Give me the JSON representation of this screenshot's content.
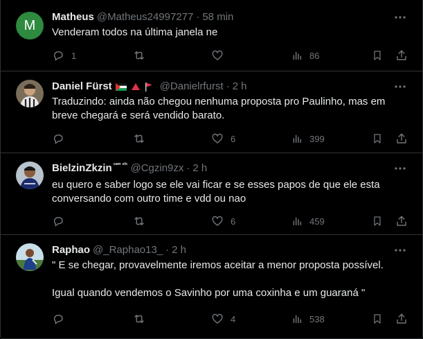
{
  "colors": {
    "background": "#000000",
    "text": "#e7e9ea",
    "muted": "#71767b",
    "divider": "#2f3336"
  },
  "tweets": [
    {
      "name": "Matheus",
      "handle": "@Matheus24997277",
      "separator": "·",
      "time": "58 min",
      "avatar_letter": "M",
      "text": [
        "Venderam todos na última janela ne"
      ],
      "replies": "1",
      "retweets": "",
      "likes": "",
      "views": "86"
    },
    {
      "name": "Daniel Fürst",
      "badges": [
        "palestine-flag-icon",
        "red-triangle-icon",
        "red-flag-icon"
      ],
      "handle": "@Danielrfurst",
      "separator": "·",
      "time": "2 h",
      "text": [
        "Traduzindo: ainda não chegou nenhuma proposta pro Paulinho, mas em breve chegará e será vendido barato."
      ],
      "replies": "",
      "retweets": "",
      "likes": "6",
      "views": "399"
    },
    {
      "name": "BielzinZkzin",
      "name_suffix": "ᶜᵃᵐ ˢᶠᶜ",
      "handle": "@Cgzin9zx",
      "separator": "·",
      "time": "2 h",
      "text": [
        "eu quero e saber logo se ele vai ficar e se esses papos de que ele esta conversando com outro time e vdd ou nao"
      ],
      "replies": "",
      "retweets": "",
      "likes": "6",
      "views": "459"
    },
    {
      "name": "Raphao",
      "handle": "@_Raphao13_",
      "separator": "·",
      "time": "2 h",
      "text": [
        "\" E se chegar, provavelmente iremos aceitar a menor proposta possível.",
        "Igual quando vendemos o Savinho por uma coxinha e um guaraná \""
      ],
      "replies": "",
      "retweets": "",
      "likes": "4",
      "views": "538"
    }
  ]
}
